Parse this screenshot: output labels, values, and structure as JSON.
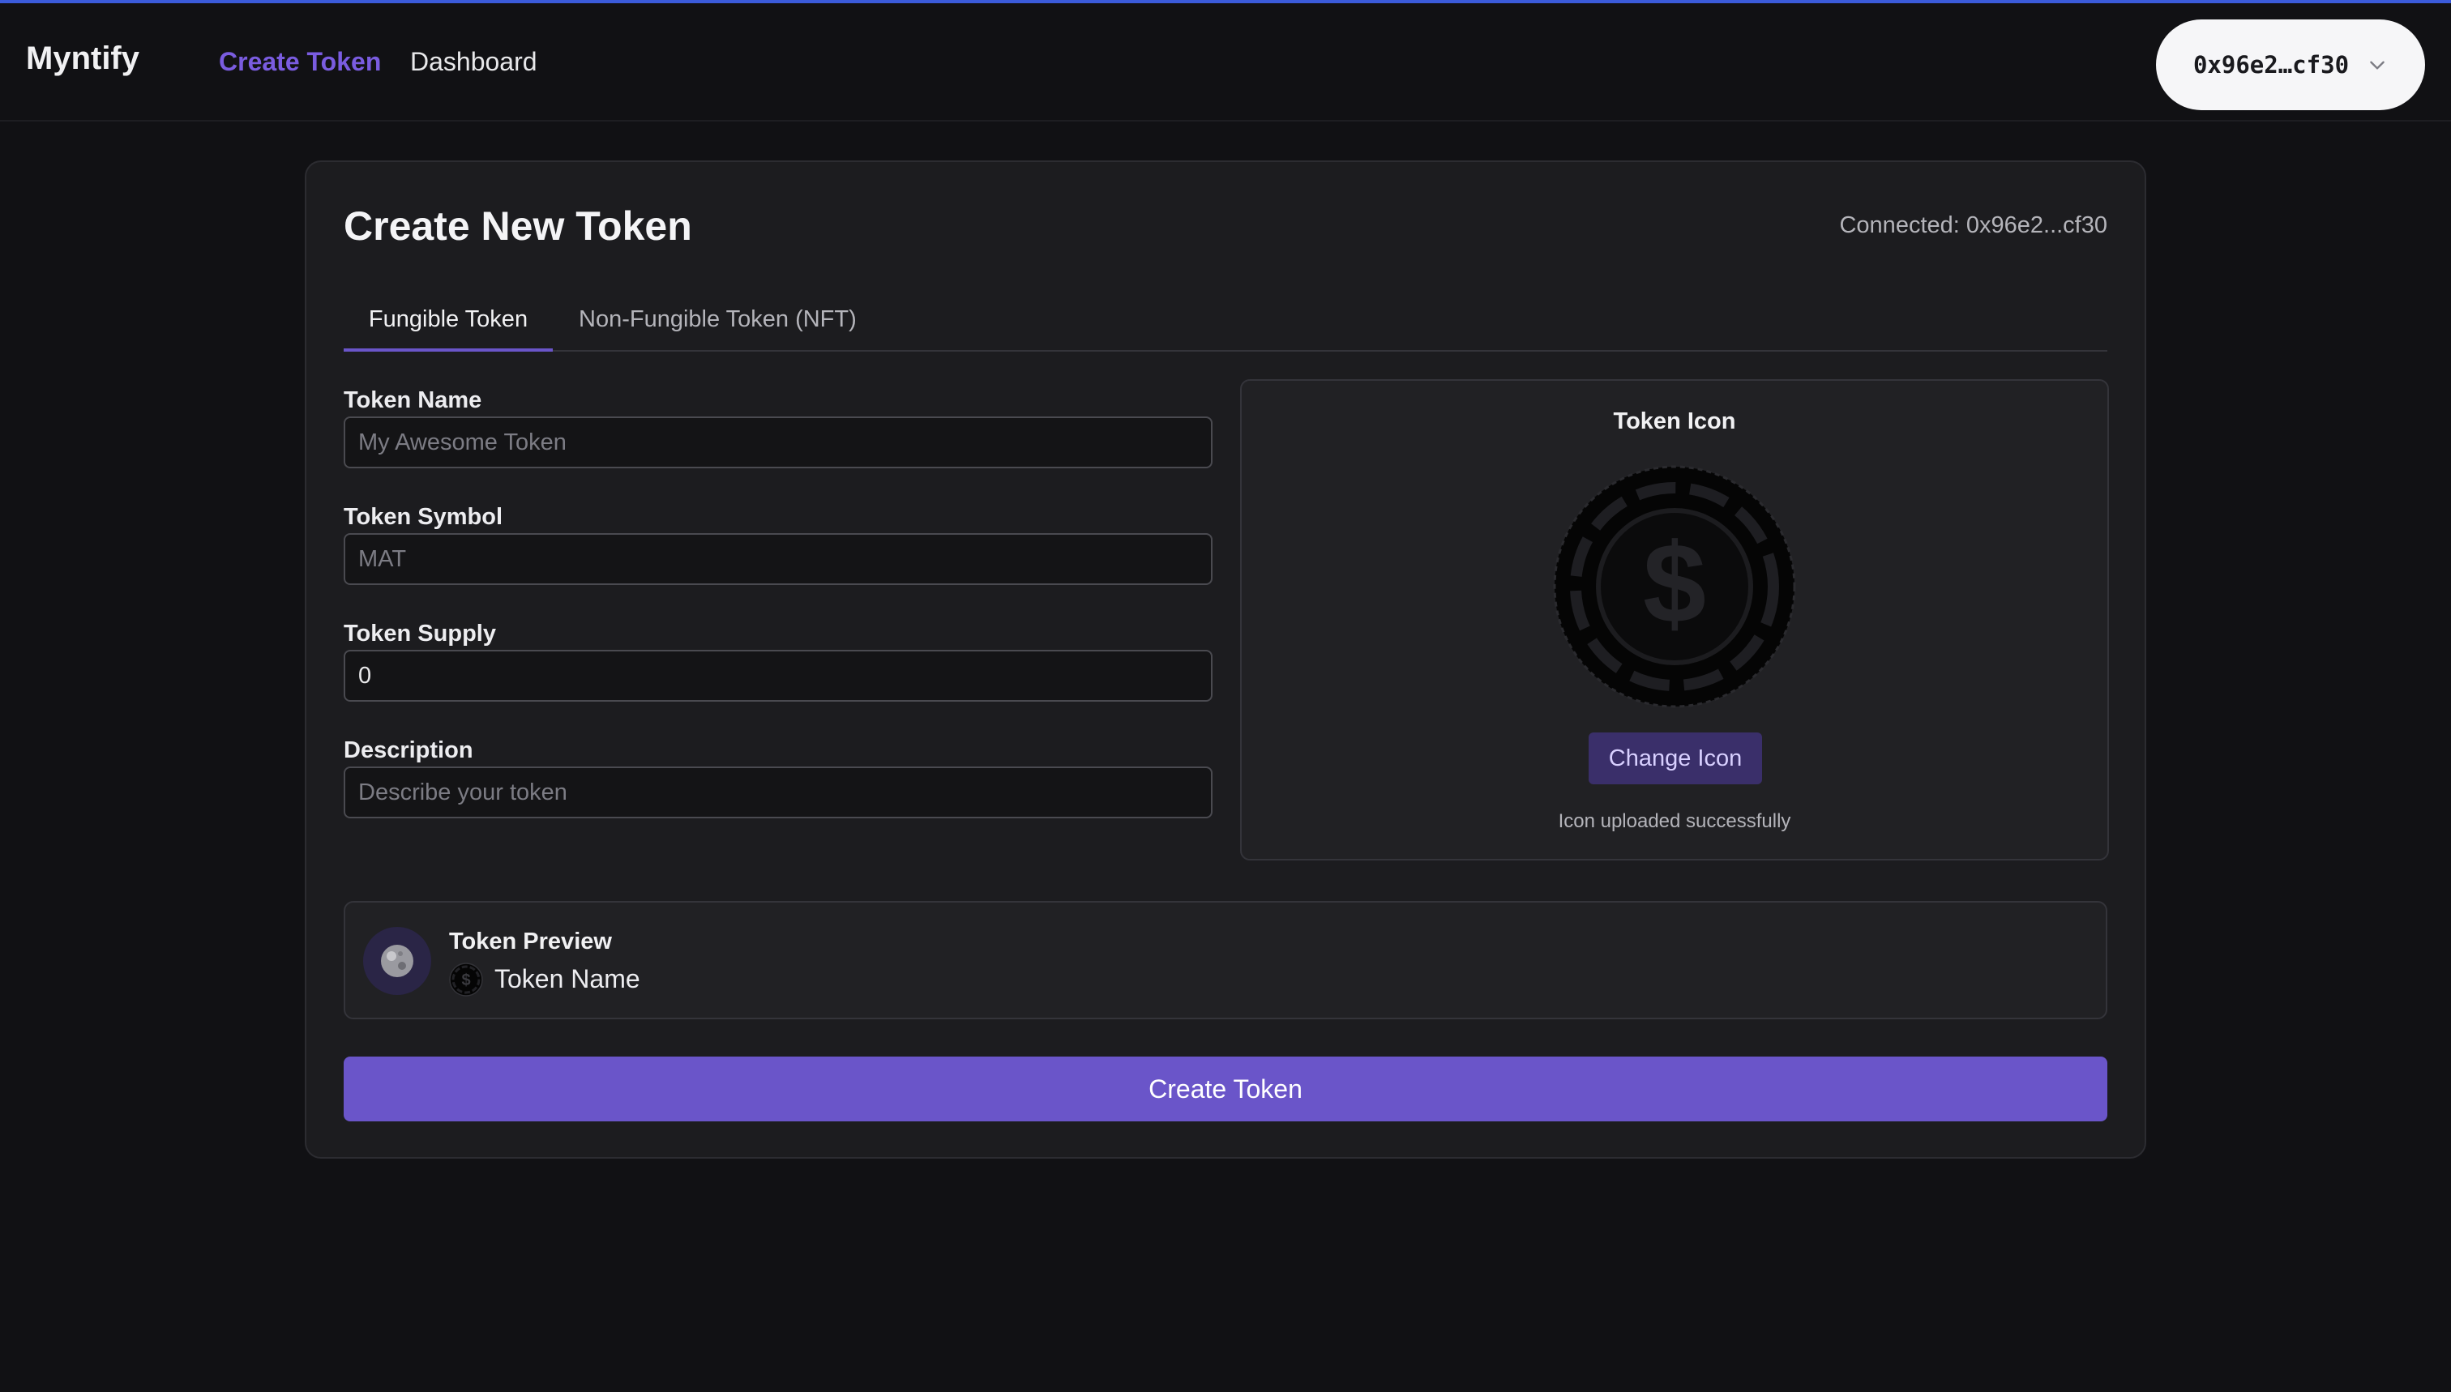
{
  "app": {
    "brand": "Myntify"
  },
  "nav": {
    "create_token": "Create Token",
    "dashboard": "Dashboard"
  },
  "wallet": {
    "address": "0x96e2…cf30"
  },
  "card": {
    "title": "Create New Token",
    "connected": "Connected: 0x96e2...cf30"
  },
  "tabs": [
    {
      "label": "Fungible Token",
      "active": true
    },
    {
      "label": "Non-Fungible Token (NFT)",
      "active": false
    }
  ],
  "form": {
    "name": {
      "label": "Token Name",
      "value": "",
      "placeholder": "My Awesome Token"
    },
    "symbol": {
      "label": "Token Symbol",
      "value": "",
      "placeholder": "MAT"
    },
    "supply": {
      "label": "Token Supply",
      "value": "0",
      "placeholder": ""
    },
    "description": {
      "label": "Description",
      "value": "",
      "placeholder": "Describe your token"
    }
  },
  "icon_panel": {
    "title": "Token Icon",
    "change_button": "Change Icon",
    "status": "Icon uploaded successfully"
  },
  "preview": {
    "title": "Token Preview",
    "name": "Token Name"
  },
  "submit": {
    "label": "Create Token"
  },
  "colors": {
    "accent": "#6a55c9",
    "nav_active": "#7a5ce0",
    "background": "#111114",
    "card": "#1c1c1f"
  }
}
